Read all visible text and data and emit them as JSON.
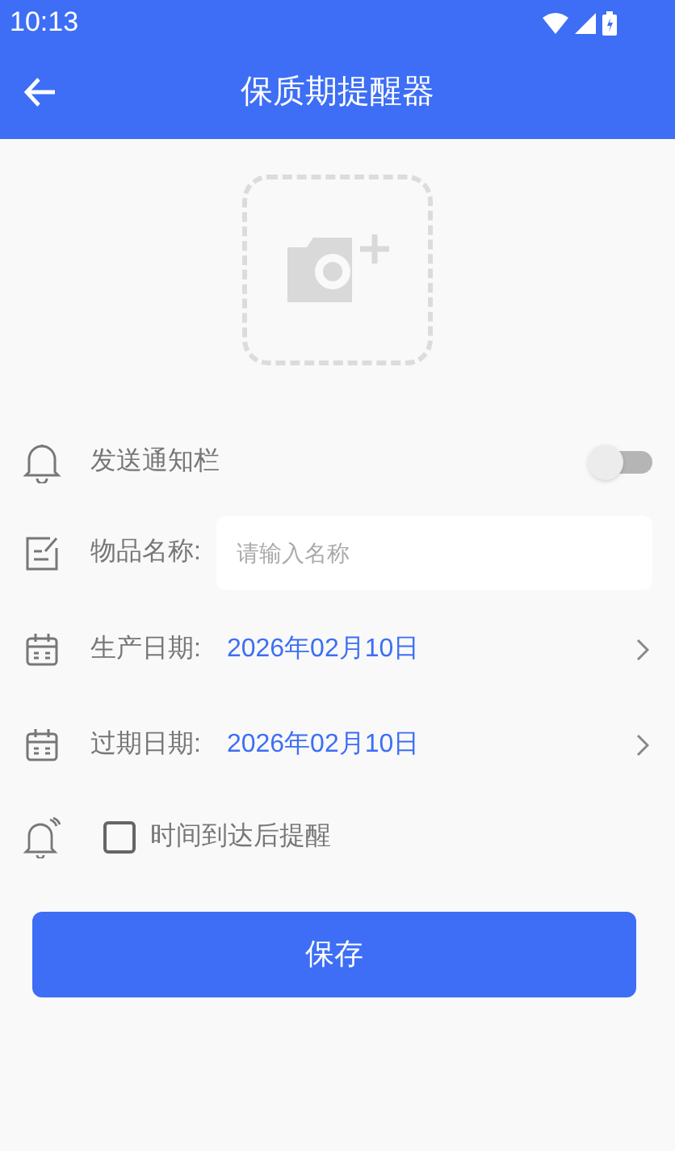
{
  "status_bar": {
    "time": "10:13"
  },
  "app_bar": {
    "title": "保质期提醒器"
  },
  "notify": {
    "label": "发送通知栏",
    "on": false
  },
  "name_field": {
    "label": "物品名称:",
    "placeholder": "请输入名称"
  },
  "dates": [
    {
      "label": "生产日期:",
      "value": "2026年02月10日"
    },
    {
      "label": "过期日期:",
      "value": "2026年02月10日"
    }
  ],
  "remind": {
    "label": "时间到达后提醒",
    "checked": false
  },
  "save_button": {
    "label": "保存"
  }
}
